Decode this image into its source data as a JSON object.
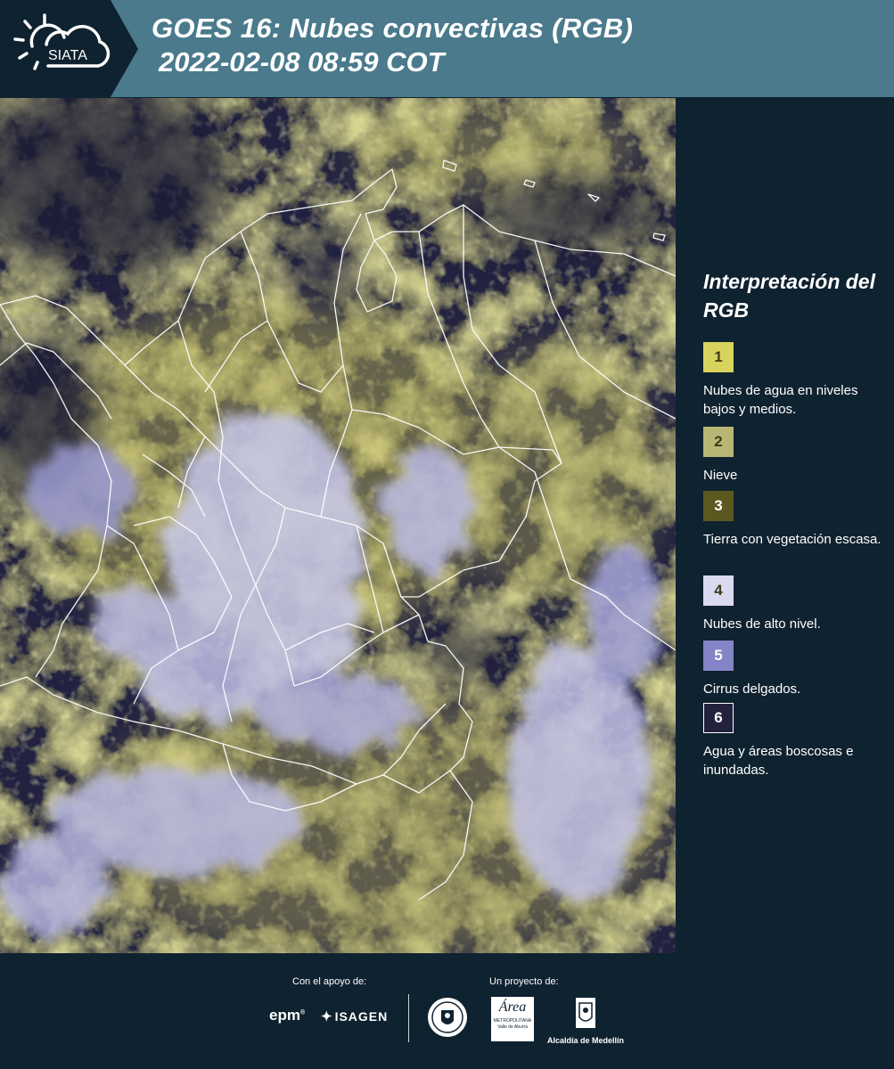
{
  "header": {
    "brand": "SIATA",
    "title_line1": "GOES 16: Nubes convectivas (RGB)",
    "title_line2": " 2022-02-08 08:59 COT"
  },
  "legend": {
    "title": "Interpretación del RGB",
    "items": [
      {
        "number": "1",
        "label": "Nubes de agua en niveles bajos y medios.",
        "color": "#d8d35c"
      },
      {
        "number": "2",
        "label": "Nieve",
        "color": "#b9b675"
      },
      {
        "number": "3",
        "label": "Tierra con vegetación escasa.",
        "color": "#5b5920"
      },
      {
        "number": "4",
        "label": "Nubes de alto nivel.",
        "color": "#d9d9ef"
      },
      {
        "number": "5",
        "label": "Cirrus delgados.",
        "color": "#8484c6"
      },
      {
        "number": "6",
        "label": "Agua y áreas boscosas e inundadas.",
        "color": "#22223d"
      }
    ]
  },
  "footer": {
    "support_caption": "Con el apoyo de:",
    "project_caption": "Un proyecto de:",
    "epm": "epm",
    "isagen": "ISAGEN",
    "area_metro": "Área",
    "area_metro_sub": "METROPOLITANA",
    "area_metro_sub2": "Valle de Aburrá",
    "alcaldia": "Alcaldía de Medellín"
  },
  "map": {
    "satellite": "GOES 16",
    "product": "Nubes convectivas (RGB)",
    "background_color": "#24243f",
    "low_cloud_color": "#c9c45a",
    "high_cloud_color": "#c6c6ea",
    "border_color": "#ffffff"
  }
}
